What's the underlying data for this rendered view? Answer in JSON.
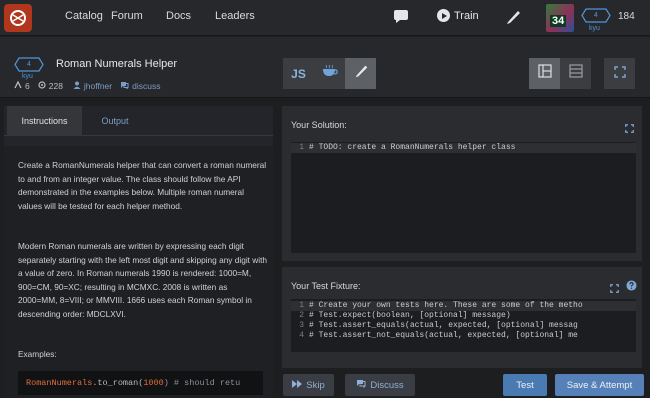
{
  "nav": {
    "links": [
      "Catalog",
      "Forum",
      "Docs",
      "Leaders"
    ],
    "train_label": "Train",
    "avatar_number": "34",
    "rank": "4",
    "rank_unit": "kyu",
    "honor": "184",
    "icons": [
      "codewars-logo-icon",
      "chat-icon",
      "play-icon",
      "editor-icon"
    ]
  },
  "kata": {
    "rank": "4",
    "rank_unit": "kyu",
    "title": "Roman Numerals Helper",
    "votes": "6",
    "completed": "228",
    "author": "jhoffner",
    "discuss": "discuss",
    "language_tabs": [
      "JS",
      "coffee-icon",
      "editor-icon"
    ],
    "layout_buttons": [
      "split-layout-icon",
      "stacked-layout-icon"
    ]
  },
  "instructions": {
    "tabs": [
      "Instructions",
      "Output"
    ],
    "paragraph1": "Create a RomanNumerals helper that can convert a roman numeral to and from an integer value. The class should follow the API demonstrated in the examples below. Multiple roman numeral values will be tested for each helper method.",
    "paragraph2": "Modern Roman numerals are written by expressing each digit separately starting with the left most digit and skipping any digit with a value of zero. In Roman numerals 1990 is rendered: 1000=M, 900=CM, 90=XC; resulting in MCMXC. 2008 is written as 2000=MM, 8=VIII; or MMVIII. 1666 uses each Roman symbol in descending order: MDCLXVI.",
    "examples_label": "Examples:",
    "code": {
      "class": "RomanNumerals",
      "method": ".to_roman(",
      "arg": "1000",
      "rest": ") # should retu"
    }
  },
  "solution": {
    "title": "Your Solution:",
    "lines": [
      {
        "n": "1",
        "text": "# TODO: create a RomanNumerals helper class"
      }
    ]
  },
  "fixture": {
    "title": "Your Test Fixture:",
    "lines": [
      {
        "n": "1",
        "text": "# Create your own tests here. These are some of the metho"
      },
      {
        "n": "2",
        "text": "#  Test.expect(boolean, [optional] message)"
      },
      {
        "n": "3",
        "text": "#  Test.assert_equals(actual, expected, [optional] messag"
      },
      {
        "n": "4",
        "text": "#  Test.assert_not_equals(actual, expected, [optional] me"
      }
    ]
  },
  "actions": {
    "skip": "Skip",
    "discuss": "Discuss",
    "test": "Test",
    "save_attempt": "Save & Attempt"
  }
}
